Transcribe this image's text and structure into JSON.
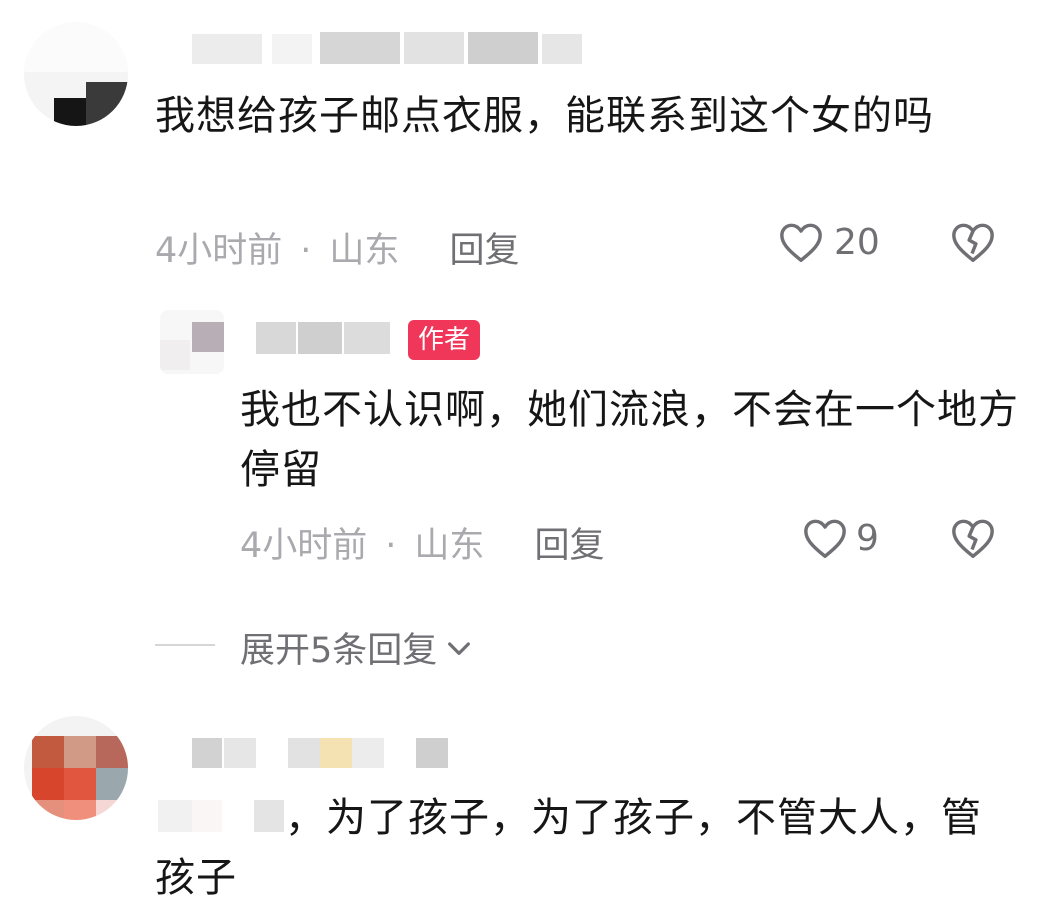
{
  "comments": [
    {
      "text": "我想给孩子邮点衣服，能联系到这个女的吗",
      "time": "4小时前",
      "location": "山东",
      "reply_label": "回复",
      "likes": "20",
      "replies": [
        {
          "badge": "作者",
          "text": "我也不认识啊，她们流浪，不会在一个地方停留",
          "time": "4小时前",
          "location": "山东",
          "reply_label": "回复",
          "likes": "9"
        }
      ],
      "expand_label": "展开5条回复"
    },
    {
      "text": "，为了孩子，为了孩子，不管大人，管孩子"
    }
  ],
  "meta_separator": "·",
  "icons": [
    "heart-outline-icon",
    "broken-heart-icon",
    "chevron-down-icon"
  ],
  "colors": {
    "author_badge": "#f0375a",
    "meta_gray": "#a9a9ae",
    "action_gray": "#6f6f74"
  }
}
